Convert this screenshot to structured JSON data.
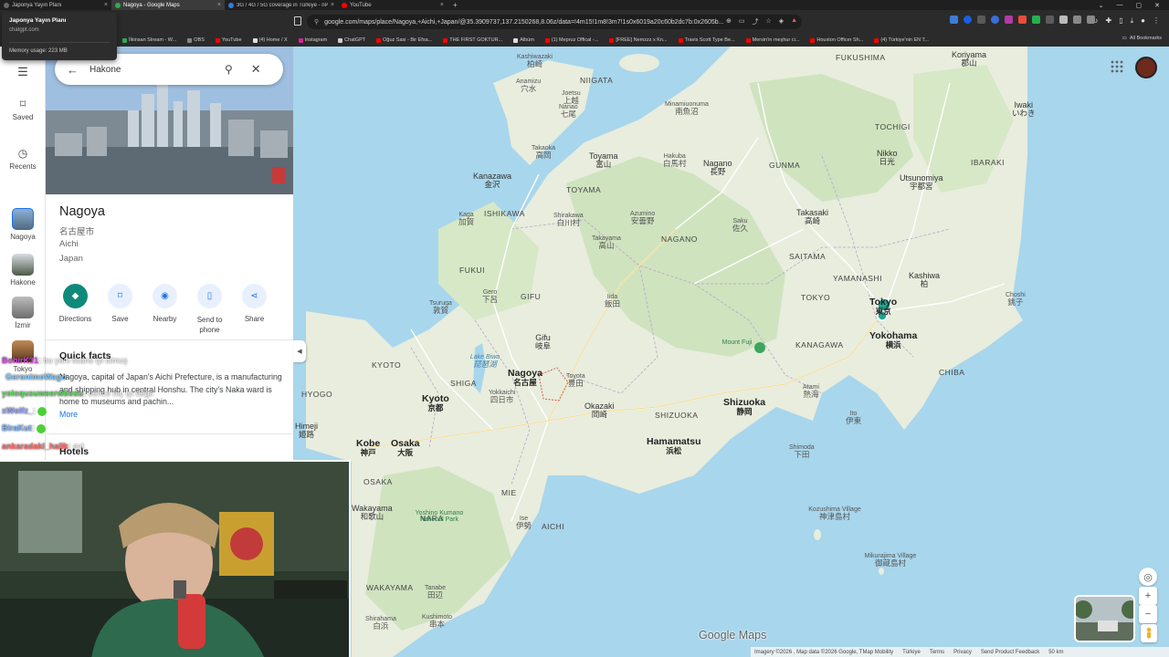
{
  "browser": {
    "tabs": [
      {
        "title": "Japonya Yayın Planı",
        "favicon_color": "#6a6a6a",
        "active": false
      },
      {
        "title": "Nagoya - Google Maps",
        "favicon_color": "#34a853",
        "active": true
      },
      {
        "title": "3G / 4G / 5G coverage in Türkiye - nPe",
        "favicon_color": "#2f7de1",
        "active": false
      },
      {
        "title": "YouTube",
        "favicon_color": "#ff0000",
        "active": false
      }
    ],
    "new_tab_icon": "+",
    "url": "google.com/maps/place/Nagoya,+Aichi,+Japan/@35.3909737,137.2150268,8.06z/data=!4m15!1m8!3m7!1s0x6019a20c60b2dc7b:0x2605b...",
    "bookmarks": [
      {
        "label": "İlkinsan Stream - W...",
        "color": "#34a853"
      },
      {
        "label": "OBS",
        "color": "#888888"
      },
      {
        "label": "YouTube",
        "color": "#ff0000"
      },
      {
        "label": "(4) Home / X",
        "color": "#e0e0e0"
      },
      {
        "label": "Instagram",
        "color": "#d6249f"
      },
      {
        "label": "ChatGPT",
        "color": "#cccccc"
      },
      {
        "label": "Oğuz Sasi - Bir Efsa...",
        "color": "#ff0000"
      },
      {
        "label": "THE FIRST GOKTUR...",
        "color": "#ff0000"
      },
      {
        "label": "Albüm",
        "color": "#dddddd"
      },
      {
        "label": "(1) Mepruz Offical -...",
        "color": "#ff0000"
      },
      {
        "label": "[FREE] Nemzzz x Kn...",
        "color": "#ff0000"
      },
      {
        "label": "Travis Scott Type Be...",
        "color": "#ff0000"
      },
      {
        "label": "Mersin'in meşhur ci...",
        "color": "#ff0000"
      },
      {
        "label": "Houston Officer Sh...",
        "color": "#ff0000"
      },
      {
        "label": "(4) Türkiye'nin EN T...",
        "color": "#ff0000"
      }
    ],
    "all_bookmarks": "All Bookmarks",
    "tab_tooltip": {
      "title": "Japonya Yayın Planı",
      "domain": "chatgpt.com",
      "memory": "Memory usage: 223 MB"
    }
  },
  "search": {
    "value": "Hakone"
  },
  "rail": {
    "items": [
      {
        "label": "Saved"
      },
      {
        "label": "Recents"
      },
      {
        "label": "Nagoya"
      },
      {
        "label": "Hakone"
      },
      {
        "label": "İzmir"
      },
      {
        "label": "Tokyo"
      }
    ]
  },
  "place": {
    "name": "Nagoya",
    "name_jp": "名古屋市",
    "region": "Aichi",
    "country": "Japan",
    "actions": [
      {
        "label": "Directions"
      },
      {
        "label": "Save"
      },
      {
        "label": "Nearby"
      },
      {
        "label": "Send to phone"
      },
      {
        "label": "Share"
      }
    ],
    "quick_facts_title": "Quick facts",
    "quick_facts_text": "Nagoya, capital of Japan's Aichi Prefecture, is a manufacturing and shipping hub in central Honshu. The city's Naka ward is home to museums and pachin...",
    "more": "More",
    "hotels_title": "Hotels"
  },
  "chat": [
    {
      "user": "BohirK31",
      "text": "bu yeni lisans iyi olmuş",
      "color": "#d04bd8"
    },
    {
      "user": "GeronimoWago",
      "text": "",
      "color": "#7dc8ff"
    },
    {
      "user": "yoloqusuweerwbeuu",
      "text": "bence hiç iyi değil",
      "color": "#5cd65c"
    },
    {
      "user": "xWolfz_",
      "text": "",
      "color": "#8da0ff"
    },
    {
      "user": "BiraKut",
      "text": "",
      "color": "#7db3ff"
    },
    {
      "user": "ankaradakl_hallk",
      "text": "evt",
      "color": "#ff6b6b"
    }
  ],
  "map": {
    "labels": [
      {
        "text": "Kashiwazaki",
        "jp": "柏崎",
        "cls": "small"
      },
      {
        "text": "NIIGATA",
        "jp": "",
        "cls": "pref"
      },
      {
        "text": "FUKUSHIMA",
        "jp": "",
        "cls": "pref"
      },
      {
        "text": "Koriyama",
        "jp": "郡山",
        "cls": ""
      },
      {
        "text": "Iwaki",
        "jp": "いわき",
        "cls": ""
      },
      {
        "text": "Anamizu",
        "jp": "穴水",
        "cls": "small"
      },
      {
        "text": "Nanao",
        "jp": "七尾",
        "cls": "small"
      },
      {
        "text": "Joetsu",
        "jp": "上越",
        "cls": "small"
      },
      {
        "text": "Minamiuonuma",
        "jp": "南魚沼",
        "cls": "small"
      },
      {
        "text": "Takaoka",
        "jp": "高岡",
        "cls": "small"
      },
      {
        "text": "Toyama",
        "jp": "富山",
        "cls": ""
      },
      {
        "text": "Hakuba",
        "jp": "白馬村",
        "cls": "small"
      },
      {
        "text": "Nagano",
        "jp": "長野",
        "cls": ""
      },
      {
        "text": "GUNMA",
        "jp": "",
        "cls": "pref"
      },
      {
        "text": "TOCHIGI",
        "jp": "",
        "cls": "pref"
      },
      {
        "text": "Nikko",
        "jp": "日光",
        "cls": ""
      },
      {
        "text": "IBARAKI",
        "jp": "",
        "cls": "pref"
      },
      {
        "text": "Utsunomiya",
        "jp": "宇都宮",
        "cls": ""
      },
      {
        "text": "Kanazawa",
        "jp": "金沢",
        "cls": ""
      },
      {
        "text": "TOYAMA",
        "jp": "",
        "cls": "pref"
      },
      {
        "text": "ISHIKAWA",
        "jp": "",
        "cls": "pref"
      },
      {
        "text": "Shirakawa",
        "jp": "白川村",
        "cls": "small"
      },
      {
        "text": "Azumino",
        "jp": "安曇野",
        "cls": "small"
      },
      {
        "text": "Saku",
        "jp": "佐久",
        "cls": "small"
      },
      {
        "text": "Takasaki",
        "jp": "高崎",
        "cls": ""
      },
      {
        "text": "Kaga",
        "jp": "加賀",
        "cls": "small"
      },
      {
        "text": "Takayama",
        "jp": "高山",
        "cls": "small"
      },
      {
        "text": "NAGANO",
        "jp": "",
        "cls": "pref"
      },
      {
        "text": "SAITAMA",
        "jp": "",
        "cls": "pref"
      },
      {
        "text": "Kashiwa",
        "jp": "柏",
        "cls": ""
      },
      {
        "text": "FUKUI",
        "jp": "",
        "cls": "pref"
      },
      {
        "text": "Gero",
        "jp": "下呂",
        "cls": "small"
      },
      {
        "text": "GIFU",
        "jp": "",
        "cls": "pref"
      },
      {
        "text": "Iida",
        "jp": "飯田",
        "cls": "small"
      },
      {
        "text": "YAMANASHI",
        "jp": "",
        "cls": "pref"
      },
      {
        "text": "TOKYO",
        "jp": "",
        "cls": "pref"
      },
      {
        "text": "Tokyo",
        "jp": "東京",
        "cls": "big"
      },
      {
        "text": "Choshi",
        "jp": "銚子",
        "cls": "small"
      },
      {
        "text": "Tsuruga",
        "jp": "敦賀",
        "cls": "small"
      },
      {
        "text": "Gifu",
        "jp": "岐阜",
        "cls": ""
      },
      {
        "text": "Mount Fuji",
        "jp": "",
        "cls": "small green"
      },
      {
        "text": "Yokohama",
        "jp": "横浜",
        "cls": "big"
      },
      {
        "text": "KYOTO",
        "jp": "",
        "cls": "pref"
      },
      {
        "text": "Lake Biwa",
        "jp": "琵琶湖",
        "cls": "small water"
      },
      {
        "text": "Nagoya",
        "jp": "名古屋",
        "cls": "big"
      },
      {
        "text": "Toyota",
        "jp": "豊田",
        "cls": "small"
      },
      {
        "text": "KANAGAWA",
        "jp": "",
        "cls": "pref"
      },
      {
        "text": "CHIBA",
        "jp": "",
        "cls": "pref"
      },
      {
        "text": "SHIGA",
        "jp": "",
        "cls": "pref"
      },
      {
        "text": "HYOGO",
        "jp": "",
        "cls": "pref"
      },
      {
        "text": "Kyoto",
        "jp": "京都",
        "cls": "big"
      },
      {
        "text": "Yokkaichi",
        "jp": "四日市",
        "cls": "small"
      },
      {
        "text": "Okazaki",
        "jp": "岡崎",
        "cls": ""
      },
      {
        "text": "Shizuoka",
        "jp": "静岡",
        "cls": "big"
      },
      {
        "text": "Atami",
        "jp": "熱海",
        "cls": "small"
      },
      {
        "text": "Himeji",
        "jp": "姫路",
        "cls": ""
      },
      {
        "text": "SHIZUOKA",
        "jp": "",
        "cls": "pref"
      },
      {
        "text": "Ito",
        "jp": "伊東",
        "cls": "small"
      },
      {
        "text": "Kobe",
        "jp": "神戸",
        "cls": "big"
      },
      {
        "text": "Osaka",
        "jp": "大阪",
        "cls": "big"
      },
      {
        "text": "Hamamatsu",
        "jp": "浜松",
        "cls": "big"
      },
      {
        "text": "Shimoda",
        "jp": "下田",
        "cls": "small"
      },
      {
        "text": "MIE",
        "jp": "",
        "cls": "pref"
      },
      {
        "text": "Ise",
        "jp": "伊勢",
        "cls": "small"
      },
      {
        "text": "OSAKA",
        "jp": "",
        "cls": "pref"
      },
      {
        "text": "NARA",
        "jp": "",
        "cls": "pref"
      },
      {
        "text": "AICHI",
        "jp": "",
        "cls": "pref"
      },
      {
        "text": "Wakayama",
        "jp": "和歌山",
        "cls": ""
      },
      {
        "text": "Yoshino Kumano National Park",
        "jp": "",
        "cls": "small green"
      },
      {
        "text": "Kozushima Village",
        "jp": "神津島村",
        "cls": "small"
      },
      {
        "text": "Mikurajima Village",
        "jp": "御蔵島村",
        "cls": "small"
      },
      {
        "text": "WAKAYAMA",
        "jp": "",
        "cls": "pref"
      },
      {
        "text": "Tanabe",
        "jp": "田辺",
        "cls": "small"
      },
      {
        "text": "Shirahama",
        "jp": "白浜",
        "cls": "small"
      },
      {
        "text": "Kushimoto",
        "jp": "串本",
        "cls": "small"
      }
    ]
  },
  "footer": {
    "logo": "Google Maps",
    "attribution": [
      "Imagery ©2026 , Map data ©2026 Google, TMap Mobility",
      "Türkiye",
      "Terms",
      "Privacy",
      "Send Product Feedback",
      "50 km"
    ]
  },
  "colors": {
    "land": "#e8eddd",
    "green": "#cfe3bf",
    "water": "#a8d6ec",
    "road": "#ffffff",
    "accent": "#0f8a7a",
    "link": "#1a73e8"
  }
}
